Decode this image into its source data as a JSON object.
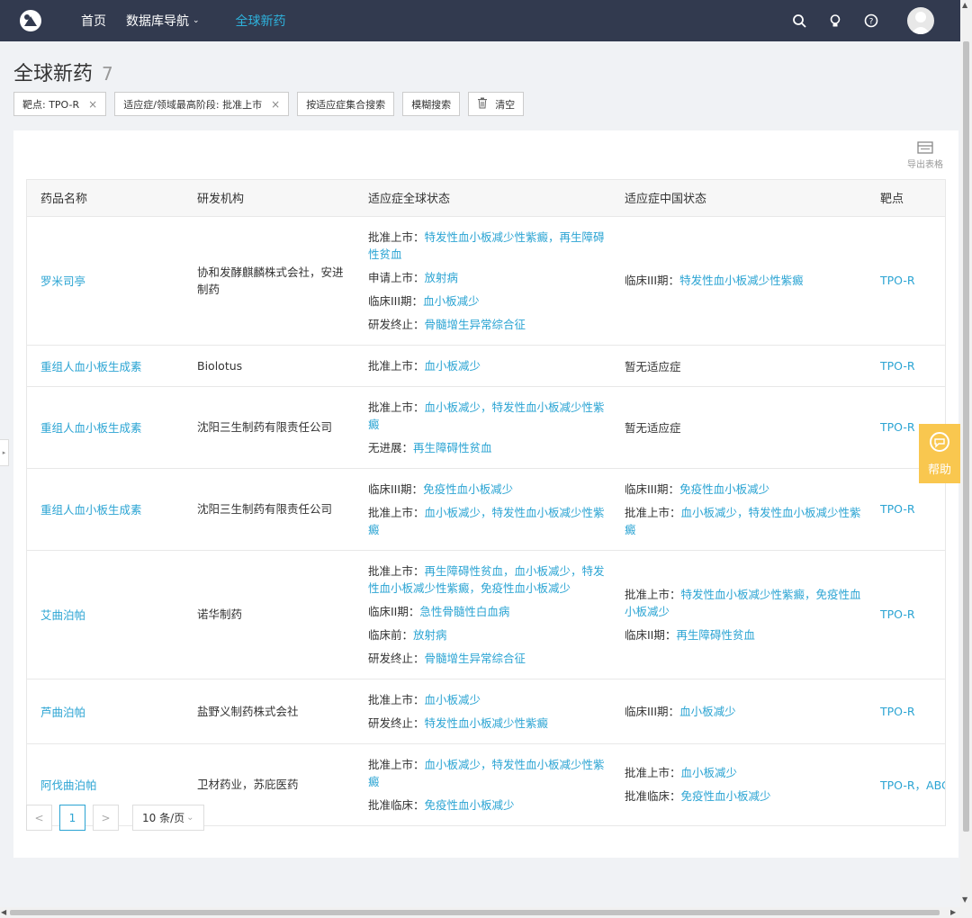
{
  "nav": {
    "home": "首页",
    "db_nav": "数据库导航",
    "active": "全球新药"
  },
  "page": {
    "title": "全球新药",
    "count": "7"
  },
  "filters": [
    {
      "label": "靶点: TPO-R",
      "close": "×"
    },
    {
      "label": "适应症/领域最高阶段: 批准上市",
      "close": "×"
    },
    {
      "label": "按适应症集合搜索"
    },
    {
      "label": "模糊搜索"
    },
    {
      "label": "清空"
    }
  ],
  "export_label": "导出表格",
  "table": {
    "headers": [
      "药品名称",
      "研发机构",
      "适应症全球状态",
      "适应症中国状态",
      "靶点"
    ],
    "rows": [
      {
        "drug": "罗米司亭",
        "org": "协和发酵麒麟株式会社，安进制药",
        "global": [
          {
            "label": "批准上市：",
            "value": "特发性血小板减少性紫癜，再生障碍性贫血"
          },
          {
            "label": "申请上市：",
            "value": "放射病"
          },
          {
            "label": "临床III期：",
            "value": "血小板减少"
          },
          {
            "label": "研发终止：",
            "value": "骨髓增生异常综合征"
          }
        ],
        "china": [
          {
            "label": "临床III期：",
            "value": "特发性血小板减少性紫癜"
          }
        ],
        "china_plain": "",
        "target": "TPO-R"
      },
      {
        "drug": "重组人血小板生成素",
        "org": "Biolotus",
        "global": [
          {
            "label": "批准上市：",
            "value": "血小板减少"
          }
        ],
        "china": [],
        "china_plain": "暂无适应症",
        "target": "TPO-R"
      },
      {
        "drug": "重组人血小板生成素",
        "org": "沈阳三生制药有限责任公司",
        "global": [
          {
            "label": "批准上市：",
            "value": "血小板减少，特发性血小板减少性紫癜"
          },
          {
            "label": "无进展：",
            "value": "再生障碍性贫血"
          }
        ],
        "china": [],
        "china_plain": "暂无适应症",
        "target": "TPO-R"
      },
      {
        "drug": "重组人血小板生成素",
        "org": "沈阳三生制药有限责任公司",
        "global": [
          {
            "label": "临床III期：",
            "value": "免疫性血小板减少"
          },
          {
            "label": "批准上市：",
            "value": "血小板减少，特发性血小板减少性紫癜"
          }
        ],
        "china": [
          {
            "label": "临床III期：",
            "value": "免疫性血小板减少"
          },
          {
            "label": "批准上市：",
            "value": "血小板减少，特发性血小板减少性紫癜"
          }
        ],
        "china_plain": "",
        "target": "TPO-R"
      },
      {
        "drug": "艾曲泊帕",
        "org": "诺华制药",
        "global": [
          {
            "label": "批准上市：",
            "value": "再生障碍性贫血，血小板减少，特发性血小板减少性紫癜，免疫性血小板减少"
          },
          {
            "label": "临床II期：",
            "value": "急性骨髓性白血病"
          },
          {
            "label": "临床前：",
            "value": "放射病"
          },
          {
            "label": "研发终止：",
            "value": "骨髓增生异常综合征"
          }
        ],
        "china": [
          {
            "label": "批准上市：",
            "value": "特发性血小板减少性紫癜，免疫性血小板减少"
          },
          {
            "label": "临床II期：",
            "value": "再生障碍性贫血"
          }
        ],
        "china_plain": "",
        "target": "TPO-R"
      },
      {
        "drug": "芦曲泊帕",
        "org": "盐野义制药株式会社",
        "global": [
          {
            "label": "批准上市：",
            "value": "血小板减少"
          },
          {
            "label": "研发终止：",
            "value": "特发性血小板减少性紫癜"
          }
        ],
        "china": [
          {
            "label": "临床III期：",
            "value": "血小板减少"
          }
        ],
        "china_plain": "",
        "target": "TPO-R"
      },
      {
        "drug": "阿伐曲泊帕",
        "org": "卫材药业，苏庇医药",
        "global": [
          {
            "label": "批准上市：",
            "value": "血小板减少，特发性血小板减少性紫癜"
          },
          {
            "label": "批准临床：",
            "value": "免疫性血小板减少"
          }
        ],
        "china": [
          {
            "label": "批准上市：",
            "value": "血小板减少"
          },
          {
            "label": "批准临床：",
            "value": "免疫性血小板减少"
          }
        ],
        "china_plain": "",
        "target": "TPO-R，ABC"
      }
    ]
  },
  "pager": {
    "prev": "<",
    "current": "1",
    "next": ">",
    "size": "10 条/页"
  },
  "help_label": "帮助",
  "colors": {
    "nav_bg": "#323a4f",
    "accent": "#2ba4d3",
    "help_bg": "#f9c74f"
  }
}
